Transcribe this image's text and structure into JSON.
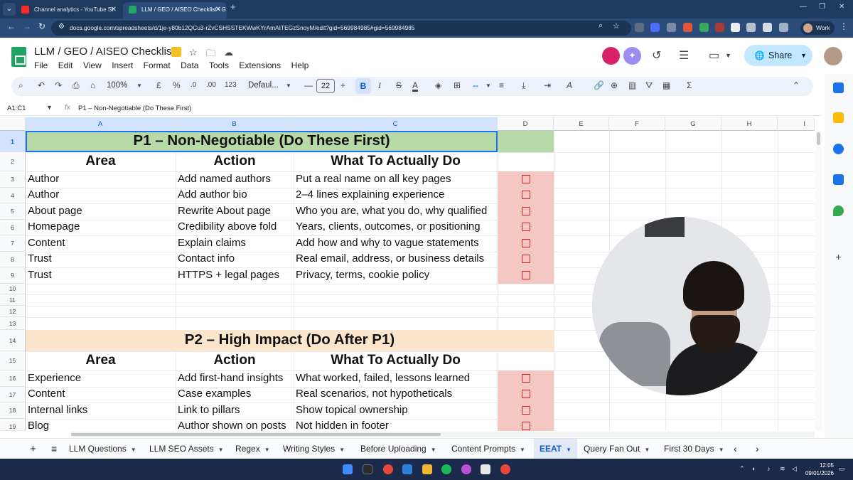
{
  "browser": {
    "tabs": [
      {
        "title": "Channel analytics - YouTube St"
      },
      {
        "title": "LLM / GEO / AISEO Checklist - G"
      }
    ],
    "url": "docs.google.com/spreadsheets/d/1je-y80b12QCu3-rZvCSHSSTEKWwKYrAmAITEGzSnoyM/edit?gid=569984985#gid=569984985",
    "profile": "Work"
  },
  "sheets": {
    "title": "LLM / GEO / AISEO Checklist",
    "menu": [
      "File",
      "Edit",
      "View",
      "Insert",
      "Format",
      "Data",
      "Tools",
      "Extensions",
      "Help"
    ],
    "share_label": "Share",
    "toolbar": {
      "zoom": "100%",
      "currency": "£",
      "percent": "%",
      "decimal_decrease": ".0",
      "decimal_increase": ".00",
      "number_format": "123",
      "font": "Defaul...",
      "font_size": "22",
      "bold": "B",
      "italic": "I",
      "strike": "S",
      "text_color": "A",
      "sum": "Σ"
    },
    "namebox": "A1:C1",
    "fx": "fx",
    "formula": "P1 – Non-Negotiable (Do These First)",
    "columns": [
      "A",
      "B",
      "C",
      "D",
      "E",
      "F",
      "G",
      "H",
      "I"
    ],
    "rows": [
      "1",
      "2",
      "3",
      "4",
      "5",
      "6",
      "7",
      "8",
      "9",
      "10",
      "11",
      "12",
      "13",
      "14",
      "15",
      "16",
      "17",
      "18",
      "19"
    ]
  },
  "grid": {
    "p1_title": "P1 – Non-Negotiable (Do These First)",
    "p2_title": "P2 – High Impact (Do After P1)",
    "header_area": "Area",
    "header_action": "Action",
    "header_what": "What To Actually Do",
    "p1_rows": [
      {
        "area": "Author",
        "action": "Add named authors",
        "what": "Put a real name on all key pages"
      },
      {
        "area": "Author",
        "action": "Add author bio",
        "what": "2–4 lines explaining experience"
      },
      {
        "area": "About page",
        "action": "Rewrite About page",
        "what": "Who you are, what you do, why qualified"
      },
      {
        "area": "Homepage",
        "action": "Credibility above fold",
        "what": "Years, clients, outcomes, or positioning"
      },
      {
        "area": "Content",
        "action": "Explain claims",
        "what": "Add how and why to vague statements"
      },
      {
        "area": "Trust",
        "action": "Contact info",
        "what": "Real email, address, or business details"
      },
      {
        "area": "Trust",
        "action": "HTTPS + legal pages",
        "what": "Privacy, terms, cookie policy"
      }
    ],
    "p2_rows": [
      {
        "area": "Experience",
        "action": "Add first-hand insights",
        "what": "What worked, failed, lessons learned"
      },
      {
        "area": "Content",
        "action": "Case examples",
        "what": "Real scenarios, not hypotheticals"
      },
      {
        "area": "Internal links",
        "action": "Link to pillars",
        "what": "Show topical ownership"
      },
      {
        "area": "Blog",
        "action": "Author shown on posts",
        "what": "Not hidden in footer"
      }
    ]
  },
  "sheet_tabs": [
    {
      "label": "LLM Questions"
    },
    {
      "label": "LLM SEO Assets"
    },
    {
      "label": "Regex"
    },
    {
      "label": "Writing Styles"
    },
    {
      "label": "Before Uploading"
    },
    {
      "label": "Content Prompts"
    },
    {
      "label": "EEAT"
    },
    {
      "label": "Query Fan Out"
    },
    {
      "label": "First 30 Days"
    }
  ],
  "taskbar": {
    "time": "12:05",
    "date": "09/01/2026"
  },
  "colors": {
    "p1_band": "#b7d9a7",
    "p2_band": "#fce5cd",
    "checkbox_col": "#f4c7c3",
    "checkbox_border": "#c62828",
    "accent": "#0b57d0"
  },
  "icons": {
    "sheets_logo": "sheets-logo-icon",
    "star": "star-icon",
    "move": "folder-icon",
    "cloud": "cloud-status-icon",
    "history": "history-icon",
    "comments": "comment-icon",
    "meet": "video-icon"
  }
}
